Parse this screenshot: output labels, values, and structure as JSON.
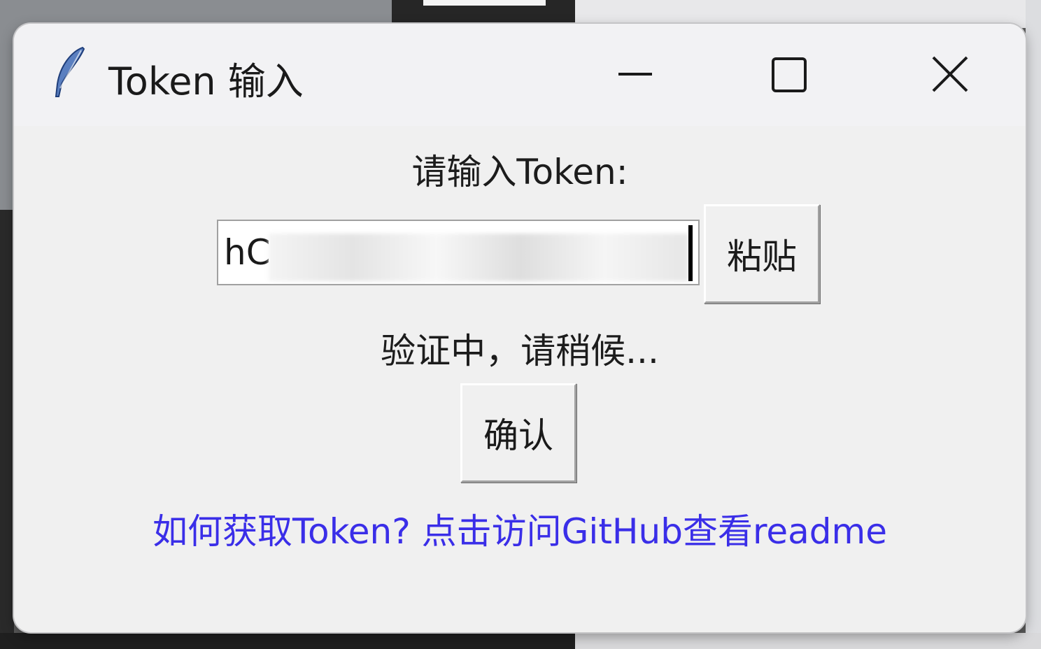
{
  "window": {
    "title": "Token 输入",
    "icon": "feather-icon",
    "controls": [
      "minimize-icon",
      "maximize-icon",
      "close-icon"
    ]
  },
  "form": {
    "prompt": "请输入Token:",
    "token_value": "hC",
    "paste_label": "粘贴",
    "status": "验证中，请稍候...",
    "confirm_label": "确认",
    "help_link": "如何获取Token? 点击访问GitHub查看readme"
  },
  "colors": {
    "link": "#3a2ee8",
    "background": "#f0f0f0"
  }
}
